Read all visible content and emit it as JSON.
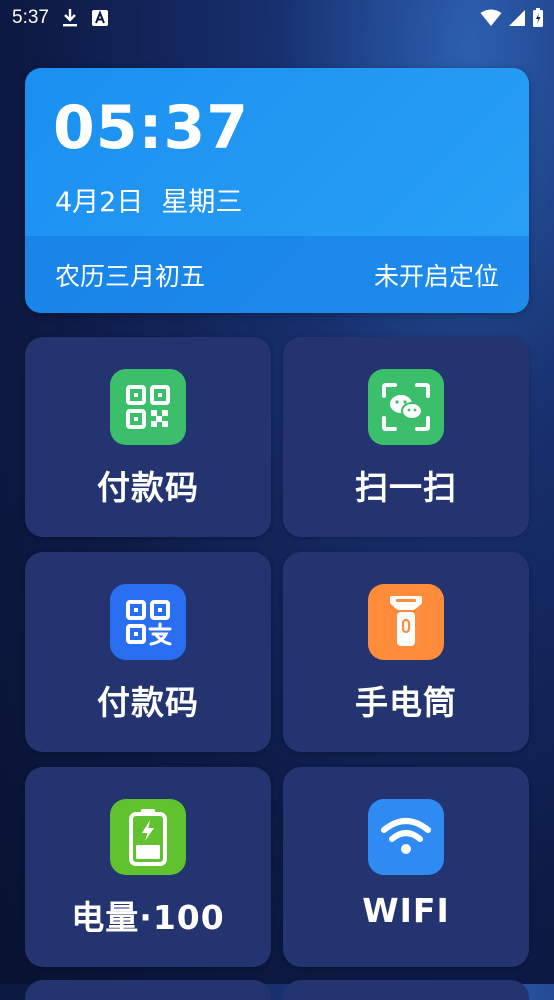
{
  "status_bar": {
    "time": "5:37",
    "left_icons": [
      "download-icon",
      "text-a-icon"
    ],
    "right_icons": [
      "wifi-icon",
      "signal-icon",
      "battery-icon"
    ]
  },
  "date_card": {
    "time": "05:37",
    "date": "4月2日",
    "weekday": "星期三",
    "lunar": "农历三月初五",
    "location": "未开启定位",
    "colors": {
      "top": "#1b8ff0",
      "bottom": "#1478e1"
    }
  },
  "tiles": [
    {
      "label": "付款码",
      "icon": "wechat-qr-code-icon",
      "color": "#3cbf6b"
    },
    {
      "label": "扫一扫",
      "icon": "wechat-scan-icon",
      "color": "#3cbf6b"
    },
    {
      "label": "付款码",
      "icon": "alipay-qr-code-icon",
      "color": "#2a6ff0"
    },
    {
      "label": "手电筒",
      "icon": "flashlight-icon",
      "color": "#ff8c3a"
    },
    {
      "label": "电量·100",
      "icon": "battery-charging-icon",
      "color": "#5fc22e"
    },
    {
      "label": "WIFI",
      "icon": "wifi-icon",
      "color": "#2f8bf2"
    }
  ],
  "colors": {
    "tile_bg": "#233470",
    "background": "#0d1a45"
  }
}
